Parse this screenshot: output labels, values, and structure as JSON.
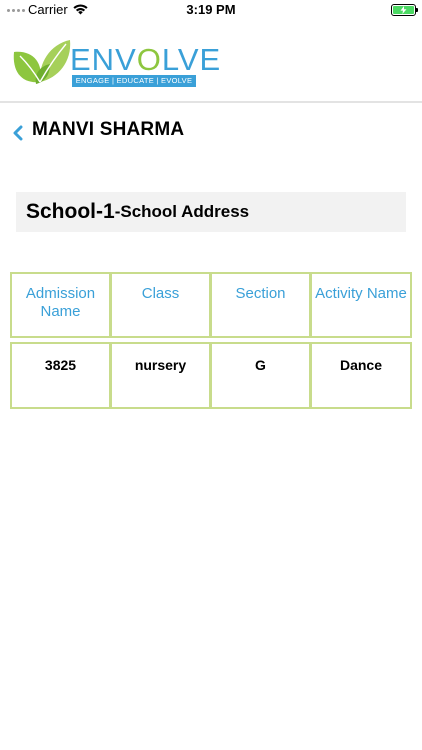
{
  "status_bar": {
    "carrier": "Carrier",
    "time": "3:19 PM",
    "battery_level": 1.0
  },
  "header": {
    "logo": {
      "word_prefix": "ENV",
      "word_highlight": "O",
      "word_suffix": "LVE",
      "tagline": "ENGAGE | EDUCATE | EVOLVE",
      "colors": {
        "blue": "#3aa0d8",
        "green": "#8dc63f"
      }
    }
  },
  "page": {
    "title": "MANVI SHARMA",
    "back_icon": "chevron-left-icon"
  },
  "school": {
    "name": "School-1",
    "address": "-School Address"
  },
  "table": {
    "columns": [
      "Admission Name",
      "Class",
      "Section",
      "Activity Name"
    ],
    "rows": [
      [
        "3825",
        "nursery",
        "G",
        "Dance"
      ]
    ],
    "border_color": "#c8dc8c",
    "header_color": "#3aa0d8"
  }
}
